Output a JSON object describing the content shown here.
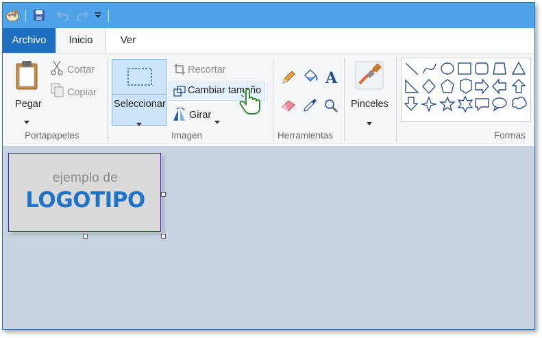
{
  "tabs": {
    "archivo": "Archivo",
    "inicio": "Inicio",
    "ver": "Ver"
  },
  "portapapeles": {
    "pegar": "Pegar",
    "cortar": "Cortar",
    "copiar": "Copiar",
    "label": "Portapapeles"
  },
  "imagen": {
    "seleccionar": "Seleccionar",
    "recortar": "Recortar",
    "cambiar_tamano": "Cambiar tamaño",
    "girar": "Girar",
    "label": "Imagen"
  },
  "herramientas": {
    "label": "Herramientas"
  },
  "pinceles": {
    "label": "Pinceles"
  },
  "formas": {
    "label": "Formas"
  },
  "canvas_image": {
    "line1": "ejemplo de",
    "line2": "LOGOTIPO"
  },
  "colors": {
    "accent": "#1e6fc2",
    "titlebar": "#4fa3e8",
    "canvas": "#c9d2e1",
    "logo_blue": "#1f74c7"
  }
}
